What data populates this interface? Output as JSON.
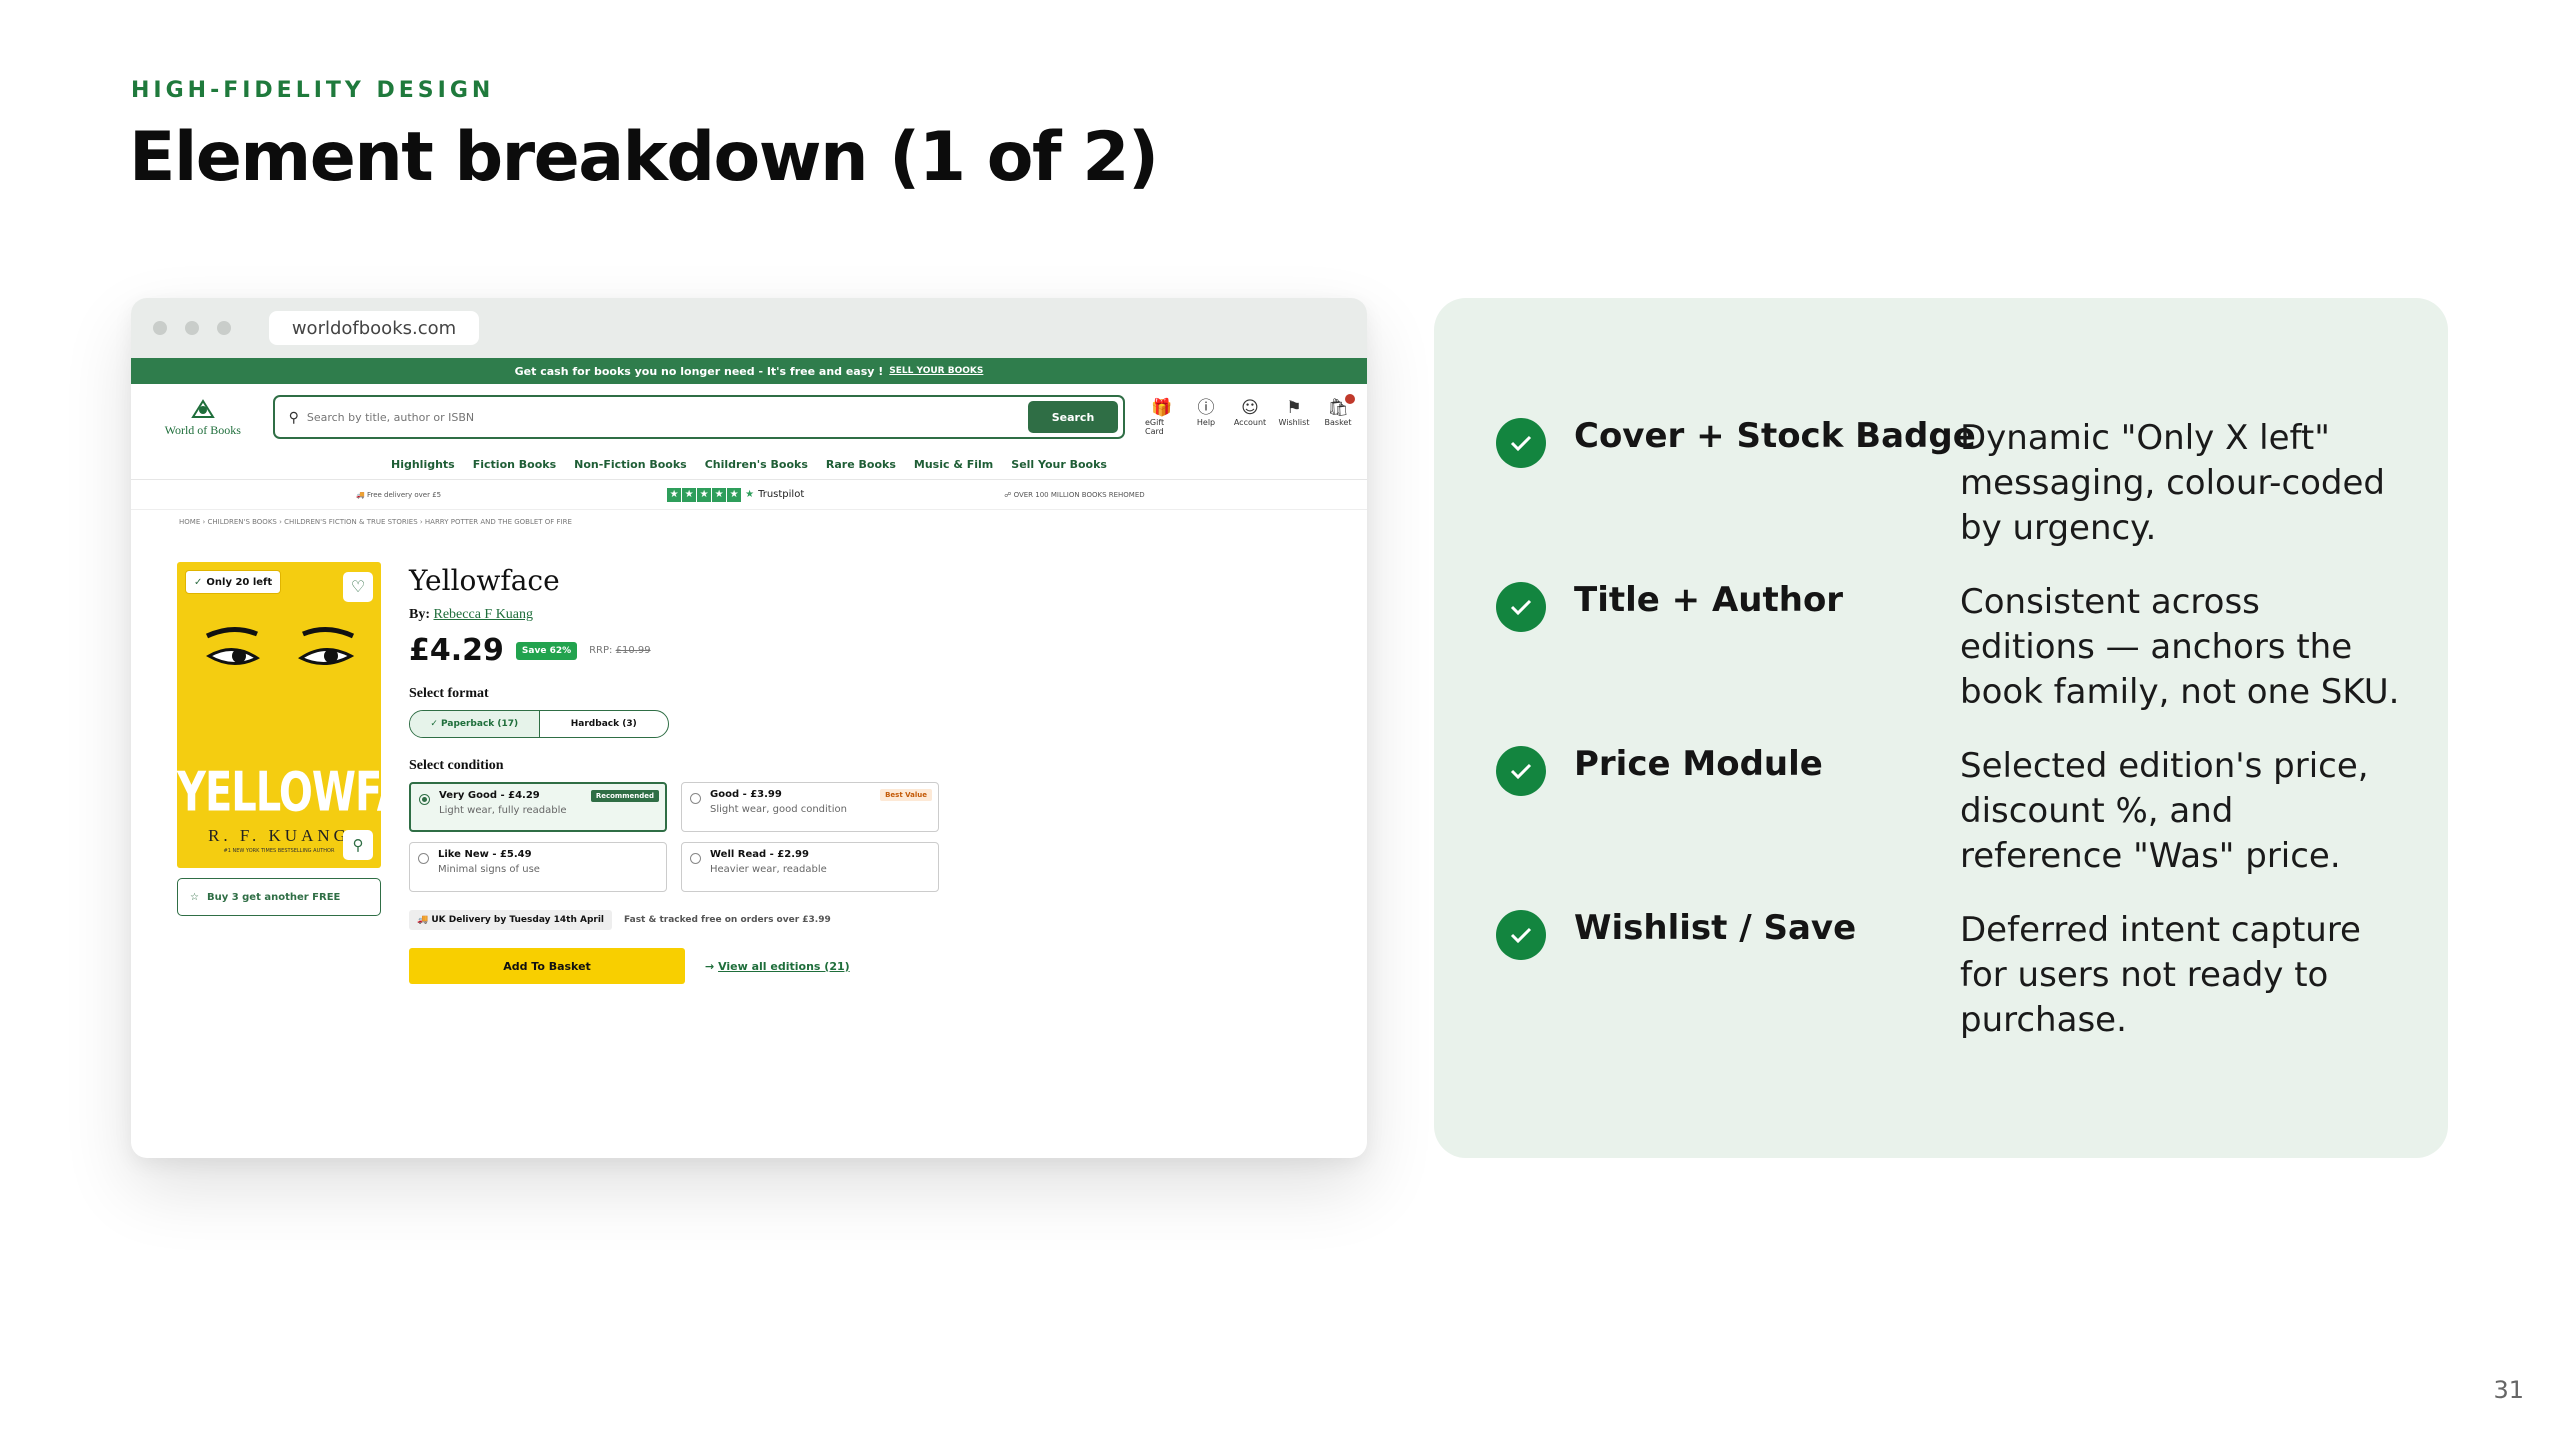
{
  "slide": {
    "eyebrow": "HIGH-FIDELITY DESIGN",
    "title": "Element breakdown (1 of 2)",
    "page_number": "31"
  },
  "browser": {
    "url": "worldofbooks.com"
  },
  "site": {
    "promo_text": "Get cash for books you no longer need - It's free and easy !",
    "promo_link": "SELL YOUR BOOKS",
    "logo_text": "World of Books",
    "search_placeholder": "Search by title, author or ISBN",
    "search_button": "Search",
    "header_icons": [
      {
        "label": "eGift Card",
        "icon": "gift-icon"
      },
      {
        "label": "Help",
        "icon": "help-icon"
      },
      {
        "label": "Account",
        "icon": "account-icon"
      },
      {
        "label": "Wishlist",
        "icon": "bookmark-icon"
      },
      {
        "label": "Basket",
        "icon": "basket-icon"
      }
    ],
    "nav": [
      "Highlights",
      "Fiction Books",
      "Non-Fiction Books",
      "Children's Books",
      "Rare Books",
      "Music & Film",
      "Sell Your Books"
    ],
    "trust": {
      "delivery": "Free delivery over £5",
      "trustpilot": "Trustpilot",
      "rehomed": "OVER 100 MILLION BOOKS REHOMED"
    },
    "breadcrumbs": [
      "HOME",
      "CHILDREN'S BOOKS",
      "CHILDREN'S FICTION & TRUE STORIES",
      "HARRY POTTER AND THE GOBLET OF FIRE"
    ]
  },
  "product": {
    "stock_badge": "Only 20 left",
    "cover_title": "YELLOWFACE",
    "cover_author": "R. F. KUANG",
    "cover_tagline": "#1 NEW YORK TIMES BESTSELLING AUTHOR",
    "bundle": "Buy 3 get another FREE",
    "title": "Yellowface",
    "by_label": "By:",
    "author": "Rebecca F Kuang",
    "price": "£4.29",
    "save": "Save 62%",
    "rrp_label": "RRP:",
    "rrp": "£10.99",
    "format_label": "Select format",
    "formats": [
      "Paperback (17)",
      "Hardback (3)"
    ],
    "condition_label": "Select condition",
    "conditions": [
      {
        "title": "Very Good - £4.29",
        "sub": "Light wear, fully readable",
        "tag": "Recommended"
      },
      {
        "title": "Good - £3.99",
        "sub": "Slight wear, good condition",
        "tag": "Best Value"
      },
      {
        "title": "Like New - £5.49",
        "sub": "Minimal signs of use",
        "tag": ""
      },
      {
        "title": "Well Read - £2.99",
        "sub": "Heavier wear, readable",
        "tag": ""
      }
    ],
    "delivery": "UK Delivery by Tuesday 14th April",
    "delivery_note": "Fast & tracked free on orders over £3.99",
    "add_to_basket": "Add To Basket",
    "view_editions": "View all editions (21)"
  },
  "features": [
    {
      "title": "Cover + Stock Badge",
      "desc": "Dynamic \"Only X left\" messaging, colour-coded by urgency."
    },
    {
      "title": "Title + Author",
      "desc": "Consistent across editions — anchors the book family, not one SKU."
    },
    {
      "title": "Price Module",
      "desc": "Selected edition's price, discount %, and reference \"Was\" price."
    },
    {
      "title": "Wishlist / Save",
      "desc": "Deferred intent capture for users not ready to purchase."
    }
  ],
  "colors": {
    "accent": "#1f7a3c",
    "panel_bg": "#e9f2eb",
    "cta_yellow": "#f8cf00",
    "cover_yellow": "#f4cd11"
  }
}
